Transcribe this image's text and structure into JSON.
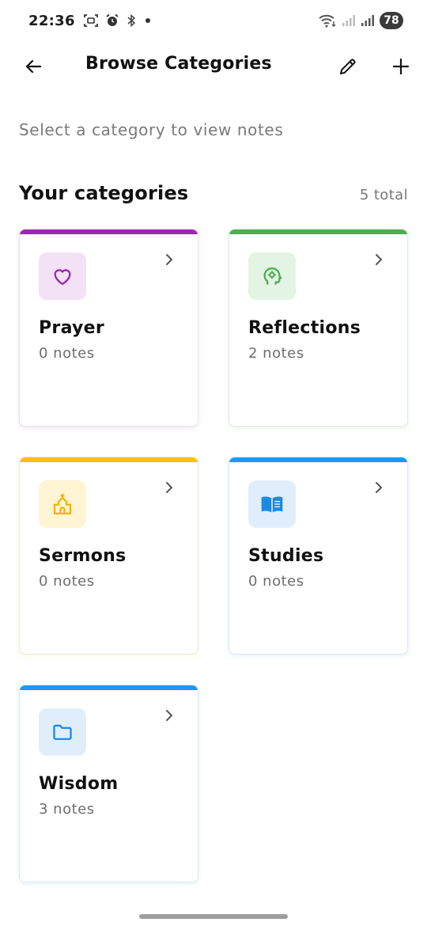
{
  "status_bar": {
    "time": "22:36",
    "battery": "78"
  },
  "app_bar": {
    "title": "Browse Categories",
    "back_icon": "arrow-left-icon",
    "edit_icon": "pencil-icon",
    "add_icon": "plus-icon"
  },
  "subtitle": "Select a category to view notes",
  "section": {
    "title": "Your categories",
    "count": "5 total"
  },
  "categories": [
    {
      "name": "Prayer",
      "count": "0 notes",
      "icon": "heart-icon",
      "accent": "#9c27b0",
      "tint": "#f3e1f6"
    },
    {
      "name": "Reflections",
      "count": "2 notes",
      "icon": "head-idea-icon",
      "accent": "#4caf50",
      "tint": "#e3f3e4"
    },
    {
      "name": "Sermons",
      "count": "0 notes",
      "icon": "church-icon",
      "accent": "#ffc107",
      "tint": "#fff4d4"
    },
    {
      "name": "Studies",
      "count": "0 notes",
      "icon": "book-open-icon",
      "accent": "#2196f3",
      "tint": "#e0eefc"
    },
    {
      "name": "Wisdom",
      "count": "3 notes",
      "icon": "folder-icon",
      "accent": "#2196f3",
      "tint": "#e0eefc"
    }
  ]
}
